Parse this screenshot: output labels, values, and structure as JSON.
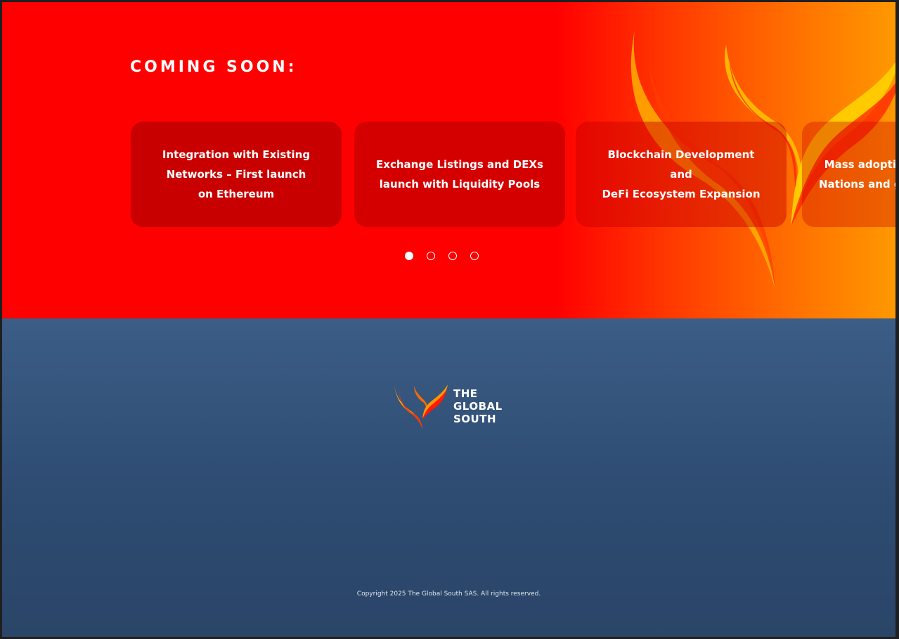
{
  "hero": {
    "title": "COMING SOON:",
    "cards": [
      {
        "lines": [
          "Integration with Existing",
          "Networks  – First launch",
          "on Ethereum"
        ]
      },
      {
        "lines": [
          "Exchange Listings and DEXs",
          "launch with Liquidity Pools"
        ]
      },
      {
        "lines": [
          "Blockchain Development and",
          "DeFi Ecosystem Expansion"
        ]
      },
      {
        "lines": [
          "Mass adopti",
          "Nations and g"
        ]
      }
    ],
    "pagination": {
      "total": 4,
      "active": 1
    }
  },
  "footer": {
    "logo": {
      "lines": [
        "THE",
        "GLOBAL",
        "SOUTH"
      ]
    },
    "copyright": "Copyright 2025 The Global South SAS. All rights reserved."
  },
  "colors": {
    "hero_red": "#ff0000",
    "hero_orange": "#ff9800",
    "card_red": "#c90000",
    "footer_blue": "#2d4a70",
    "text_white": "#ffffff"
  }
}
